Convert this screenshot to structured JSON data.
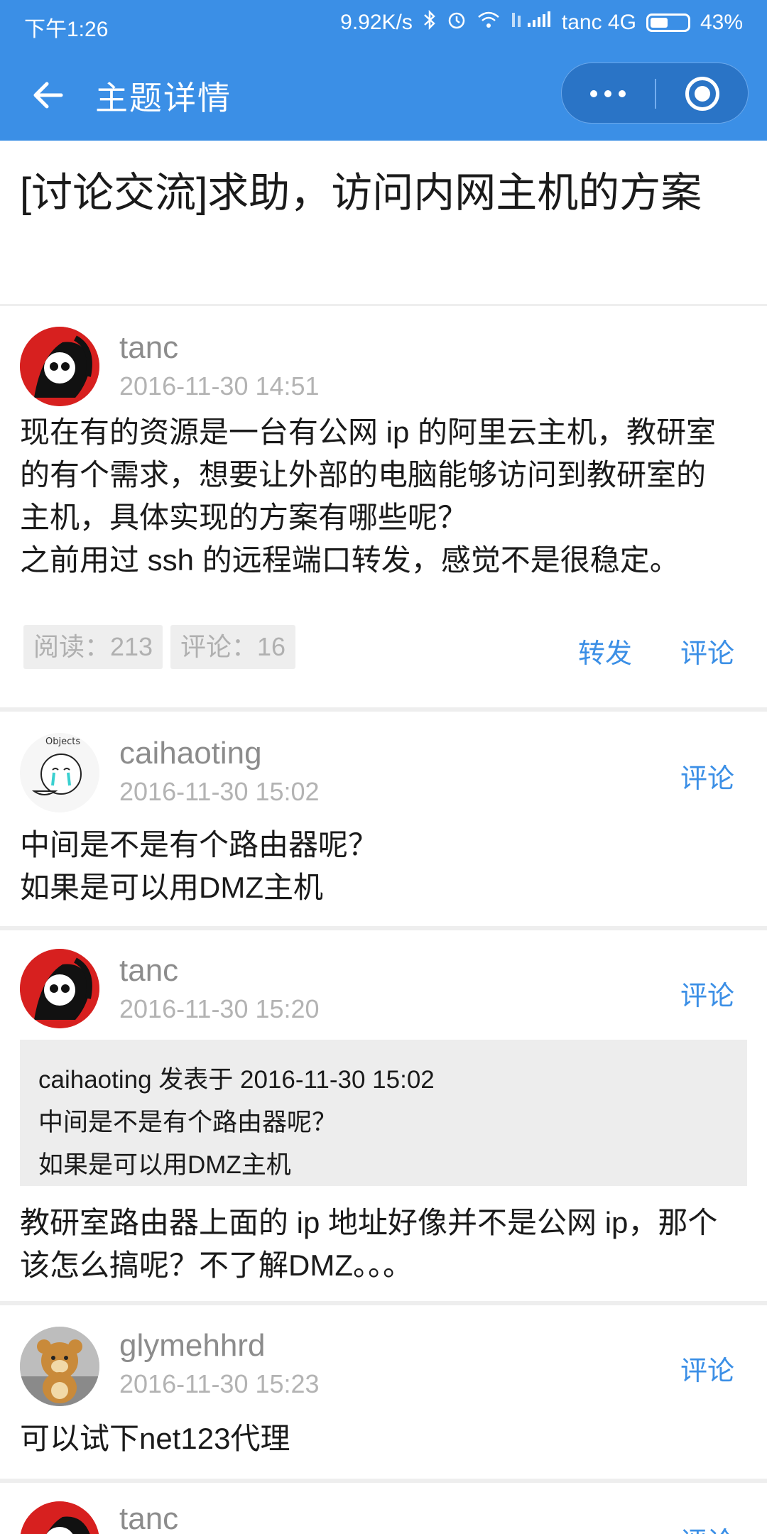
{
  "status_bar": {
    "time": "下午1:26",
    "speed": "9.92K/s",
    "carrier": "tanc 4G",
    "battery": "43%"
  },
  "nav": {
    "title": "主题详情",
    "back_icon": "back-arrow-icon",
    "more_icon": "more-dots-icon",
    "close_icon": "record-circle-icon"
  },
  "topic": {
    "title": "[讨论交流]求助，访问内网主机的方案"
  },
  "main_post": {
    "author": "tanc",
    "date": "2016-11-30 14:51",
    "content": "现在有的资源是一台有公网 ip 的阿里云主机，教研室\n的有个需求，想要让外部的电脑能够访问到教研室的\n主机，具体实现的方案有哪些呢？\n之前用过 ssh 的远程端口转发，感觉不是很稳定。",
    "reads": "阅读：213",
    "comments": "评论：16",
    "forward_label": "转发",
    "comment_label": "评论"
  },
  "replies": [
    {
      "author": "caihaoting",
      "date": "2016-11-30 15:02",
      "content": "中间是不是有个路由器呢？\n如果是可以用DMZ主机",
      "comment_label": "评论",
      "avatar_text": "Objects"
    },
    {
      "author": "tanc",
      "date": "2016-11-30 15:20",
      "quote_header": "caihaoting 发表于 2016-11-30 15:02",
      "quote_line1": "中间是不是有个路由器呢？",
      "quote_line2": "如果是可以用DMZ主机",
      "content": "教研室路由器上面的 ip 地址好像并不是公网 ip，那个\n该怎么搞呢？不了解DMZ。。。",
      "comment_label": "评论"
    },
    {
      "author": "glymehhrd",
      "date": "2016-11-30 15:23",
      "content": "可以试下net123代理",
      "comment_label": "评论"
    },
    {
      "author": "tanc",
      "comment_label": "评论"
    }
  ],
  "colors": {
    "accent": "#3b8fe6",
    "muted_text": "#8c8c8c",
    "date_text": "#b3b3b3",
    "divider": "#eeeeee"
  }
}
